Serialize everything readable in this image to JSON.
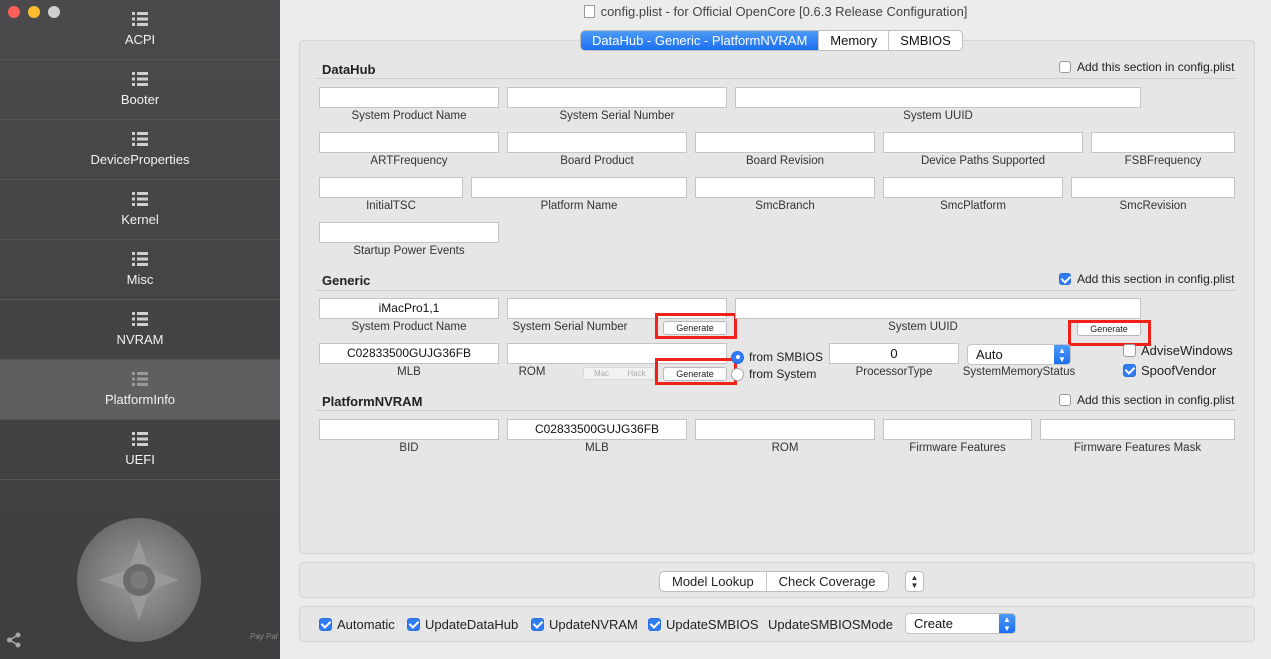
{
  "window": {
    "title": "config.plist - for Official OpenCore [0.6.3 Release Configuration]"
  },
  "sidebar": {
    "items": [
      {
        "label": "ACPI",
        "active": false
      },
      {
        "label": "Booter",
        "active": false
      },
      {
        "label": "DeviceProperties",
        "active": false
      },
      {
        "label": "Kernel",
        "active": false
      },
      {
        "label": "Misc",
        "active": false
      },
      {
        "label": "NVRAM",
        "active": false
      },
      {
        "label": "PlatformInfo",
        "active": true
      },
      {
        "label": "UEFI",
        "active": false
      }
    ],
    "paypal": "Pay Pal"
  },
  "tabs": [
    {
      "label": "DataHub - Generic - PlatformNVRAM",
      "active": true
    },
    {
      "label": "Memory",
      "active": false
    },
    {
      "label": "SMBIOS",
      "active": false
    }
  ],
  "datahub": {
    "title": "DataHub",
    "add_label": "Add this section in config.plist",
    "add_checked": false,
    "fields": {
      "system_product_name": {
        "label": "System Product Name",
        "value": ""
      },
      "system_serial_number": {
        "label": "System Serial Number",
        "value": ""
      },
      "system_uuid": {
        "label": "System UUID",
        "value": ""
      },
      "art_frequency": {
        "label": "ARTFrequency",
        "value": ""
      },
      "board_product": {
        "label": "Board Product",
        "value": ""
      },
      "board_revision": {
        "label": "Board Revision",
        "value": ""
      },
      "device_paths_supported": {
        "label": "Device Paths Supported",
        "value": ""
      },
      "fsb_frequency": {
        "label": "FSBFrequency",
        "value": ""
      },
      "initial_tsc": {
        "label": "InitialTSC",
        "value": ""
      },
      "platform_name": {
        "label": "Platform Name",
        "value": ""
      },
      "smc_branch": {
        "label": "SmcBranch",
        "value": ""
      },
      "smc_platform": {
        "label": "SmcPlatform",
        "value": ""
      },
      "smc_revision": {
        "label": "SmcRevision",
        "value": ""
      },
      "startup_power_events": {
        "label": "Startup Power Events",
        "value": ""
      }
    }
  },
  "generic": {
    "title": "Generic",
    "add_label": "Add this section in config.plist",
    "add_checked": true,
    "system_product_name": {
      "label": "System Product Name",
      "value": "iMacPro1,1"
    },
    "system_serial_number": {
      "label": "System Serial Number",
      "value": ""
    },
    "system_uuid": {
      "label": "System UUID",
      "value": ""
    },
    "mlb": {
      "label": "MLB",
      "value": "C02833500GUJG36FB"
    },
    "rom": {
      "label": "ROM",
      "value": ""
    },
    "generate_label": "Generate",
    "rom_seg": [
      "Mac",
      "Hack"
    ],
    "rom_source": {
      "from_smbios": "from SMBIOS",
      "from_system": "from System",
      "selected": "from SMBIOS"
    },
    "processor_type": {
      "label": "ProcessorType",
      "value": "0"
    },
    "system_memory_status": {
      "label": "SystemMemoryStatus",
      "value": "Auto"
    },
    "advise_windows": {
      "label": "AdviseWindows",
      "checked": false
    },
    "spoof_vendor": {
      "label": "SpoofVendor",
      "checked": true
    }
  },
  "platform_nvram": {
    "title": "PlatformNVRAM",
    "add_label": "Add this section in config.plist",
    "add_checked": false,
    "fields": {
      "bid": {
        "label": "BID",
        "value": ""
      },
      "mlb": {
        "label": "MLB",
        "value": "C02833500GUJG36FB"
      },
      "rom": {
        "label": "ROM",
        "value": ""
      },
      "firmware_features": {
        "label": "Firmware Features",
        "value": ""
      },
      "firmware_features_mask": {
        "label": "Firmware Features Mask",
        "value": ""
      }
    }
  },
  "toolbar": {
    "model_lookup": "Model Lookup",
    "check_coverage": "Check Coverage"
  },
  "bottom": {
    "automatic": {
      "label": "Automatic",
      "checked": true
    },
    "update_datahub": {
      "label": "UpdateDataHub",
      "checked": true
    },
    "update_nvram": {
      "label": "UpdateNVRAM",
      "checked": true
    },
    "update_smbios": {
      "label": "UpdateSMBIOS",
      "checked": true
    },
    "update_smbios_mode_label": "UpdateSMBIOSMode",
    "update_smbios_mode_value": "Create"
  },
  "colors": {
    "accent": "#1b6ff0",
    "highlight_box": "#f0201a",
    "sidebar_bg": "#434345"
  }
}
